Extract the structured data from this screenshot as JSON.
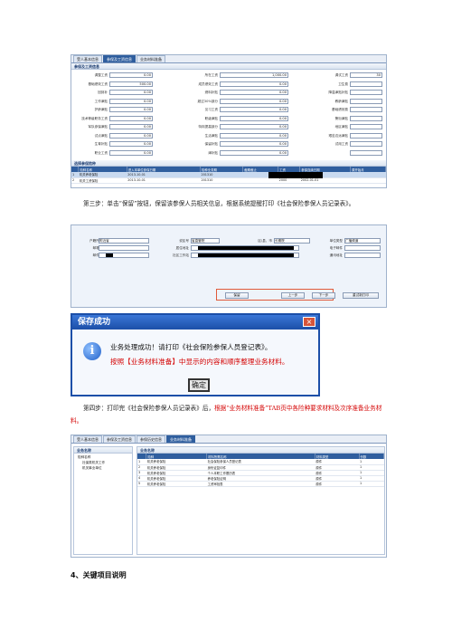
{
  "shot1": {
    "tabs": [
      "受人基本信息",
      "参保及工资信息",
      "业务材料准备"
    ],
    "panel_title": "参保及工资信息",
    "fields": [
      {
        "label": "调整工资",
        "value": "0.00"
      },
      {
        "label": "所在工资",
        "value": "1,000.00"
      },
      {
        "label": "调试工资",
        "value": "30"
      },
      {
        "label": "基础绩效工资",
        "value": "500.00"
      },
      {
        "label": "成员绩效工资",
        "value": "0.00"
      },
      {
        "label": "卫生费",
        "value": ""
      },
      {
        "label": "回到补",
        "value": "0.00"
      },
      {
        "label": "燃料补贴",
        "value": "0.00"
      },
      {
        "label": "降温津贴补贴",
        "value": ""
      },
      {
        "label": "工作津贴",
        "value": "0.00"
      },
      {
        "label": "超过30%部分",
        "value": "0.00"
      },
      {
        "label": "教龄津贴",
        "value": ""
      },
      {
        "label": "护龄津贴",
        "value": "0.00"
      },
      {
        "label": "见习工资",
        "value": "0.00"
      },
      {
        "label": "基础绩效费",
        "value": ""
      },
      {
        "label": "技术等级职务工资",
        "value": "0.00"
      },
      {
        "label": "职级津贴",
        "value": "0.00"
      },
      {
        "label": "警衔津贴",
        "value": ""
      },
      {
        "label": "军队参保津贴",
        "value": "0.00"
      },
      {
        "label": "特岗提高部分",
        "value": "0.00"
      },
      {
        "label": "地区津贴",
        "value": ""
      },
      {
        "label": "试点津贴",
        "value": "0.00"
      },
      {
        "label": "生活津贴",
        "value": "0.00"
      },
      {
        "label": "艰苦边远津贴",
        "value": ""
      },
      {
        "label": "生育补贴",
        "value": "0.00"
      },
      {
        "label": "保留补贴",
        "value": "0.00"
      },
      {
        "label": "试用工资",
        "value": ""
      },
      {
        "label": "职业工资",
        "value": "0.00"
      },
      {
        "label": "津补贴",
        "value": "0.00"
      },
      {
        "label": "",
        "value": ""
      }
    ],
    "list_title": "选择参保险种",
    "list_headers": [
      "",
      "险种名称",
      "进入本单位参保日期",
      "险种业务期",
      "截期截止",
      "工资",
      "参保连续日期",
      "原开始月"
    ],
    "rows": [
      {
        "no": "1",
        "name": "机关养老保险",
        "date": "2013-10-01",
        "period": "201310",
        "end": "",
        "wage": "2000",
        "cdate": "1965-07-01",
        "start": ""
      },
      {
        "no": "2",
        "name": "机关工资保险",
        "date": "2013-10-01",
        "period": "201310",
        "end": "",
        "wage": "2000",
        "cdate": "2002-01-01",
        "start": ""
      }
    ]
  },
  "para1": "第三步：单击“保留”按钮，保留该参保人员相关信息，根据系统提醒打印《社会保险参保人员记录表》。",
  "shot2": {
    "fields": [
      {
        "label": "户籍所在地",
        "value": "附近省"
      },
      {
        "label": "说区号",
        "value": "省直管院"
      },
      {
        "label": "区\\县、市",
        "value": "长期院"
      },
      {
        "label": "单位类型",
        "value": "广播频道"
      },
      {
        "label": "邮箱编码",
        "value": ""
      },
      {
        "label": "居住地址",
        "value": ""
      },
      {
        "label": "电子邮件",
        "value": ""
      },
      {
        "label": "邮件编码",
        "value": ""
      },
      {
        "label": "社区工作站",
        "value": ""
      },
      {
        "label": "通讯地址",
        "value": ""
      }
    ],
    "buttons": [
      "保留",
      "上一步",
      "下一步",
      "重试新打印"
    ]
  },
  "dialog": {
    "title": "保存成功",
    "close": "×",
    "icon": "i",
    "line1": "业务处理成功！请打印《社会保险参保人员登记表》。",
    "line2": "按照【业务材料准备】中显示的内容和顺序整理业务材料。",
    "ok": "确定"
  },
  "para2": {
    "part1": "第四步：打印完《社会保险参保人员记录表》后，",
    "part2": "根据“业务材料准备”TAB页中各险种要求材料及次序准备业务材料。"
  },
  "shot3": {
    "tabs": [
      "受人基本信息",
      "参保及工资信息",
      "参保历史信息",
      "业务材料准备"
    ],
    "tree_title": "业务名称",
    "tree": [
      "险种名称",
      "社保类机关工作",
      "机关事业单位"
    ],
    "list_title": "业务名称",
    "headers": [
      "",
      "险种",
      "材料所需名称",
      "材料类型",
      "份数"
    ],
    "rows": [
      {
        "no": "1",
        "type": "机关养老保险",
        "name": "社会保险参保人员登记表",
        "kind": "原件",
        "count": "1"
      },
      {
        "no": "2",
        "type": "机关养老保险",
        "name": "身份证复印件",
        "kind": "原件",
        "count": "1"
      },
      {
        "no": "3",
        "type": "机关养老保险",
        "name": "个人本职工作履历表",
        "kind": "原件",
        "count": "1"
      },
      {
        "no": "4",
        "type": "机关养老保险",
        "name": "养老保险证明",
        "kind": "原件",
        "count": "1"
      },
      {
        "no": "5",
        "type": "机关养老保险",
        "name": "工资审批表",
        "kind": "原件",
        "count": "1"
      }
    ]
  },
  "heading": "4、关键项目说明"
}
